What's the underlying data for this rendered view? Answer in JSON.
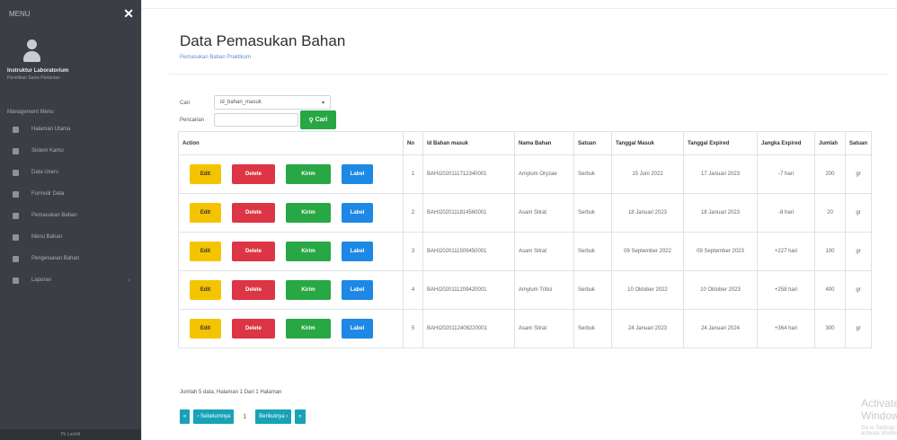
{
  "sidebar": {
    "brand": "MENU",
    "close_glyph": "✕",
    "user_name": "Instruktur Laboratorium",
    "user_role": "Penelitian Sains Pertanian",
    "section": "Management Menu",
    "items": [
      {
        "label": "Halaman Utama",
        "icon": "home-icon"
      },
      {
        "label": "Sistem Kamu",
        "icon": "system-icon"
      },
      {
        "label": "Data Users",
        "icon": "users-icon"
      },
      {
        "label": "Formulir Data",
        "icon": "form-icon"
      },
      {
        "label": "Pemasukan Bahan",
        "icon": "inbox-icon"
      },
      {
        "label": "Menu Bahan",
        "icon": "menu-icon"
      },
      {
        "label": "Pengeluaran Bahan",
        "icon": "outbox-icon"
      },
      {
        "label": "Laporan",
        "icon": "report-icon"
      }
    ],
    "footer": "Pli Lashtil"
  },
  "header": {
    "title": "Data Pemasukan Bahan",
    "subtitle": "Pemasukan Bahan Praktikum"
  },
  "search": {
    "cari_label": "Cari",
    "select_value": "id_bahan_masuk",
    "pencarian_label": "Pencarian",
    "button_label": "Cari"
  },
  "table": {
    "headers": [
      "Action",
      "No",
      "Id Bahan masuk",
      "Nama Bahan",
      "Satuan",
      "Tanggal Masuk",
      "Tanggal Expired",
      "Jangka Expired",
      "Jumlah",
      "Satuan"
    ],
    "buttons": {
      "edit": "Edit",
      "delete": "Delete",
      "kirim": "Kirim",
      "label": "Label"
    },
    "rows": [
      {
        "no": "1",
        "id": "BAHI2020111712340001",
        "nama": "Amylum Oryzae",
        "satuan": "Serbuk",
        "masuk": "15 Juni 2022",
        "expired": "17 Januari 2023",
        "jangka": "-7 hari",
        "jumlah": "200",
        "unit": "gr"
      },
      {
        "no": "2",
        "id": "BAHI2020111814560001",
        "nama": "Asam Sitrat",
        "satuan": "Serbuk",
        "masuk": "18 Januari 2023",
        "expired": "18 Januari 2023",
        "jangka": "-8 hari",
        "jumlah": "20",
        "unit": "gr"
      },
      {
        "no": "3",
        "id": "BAHI2020111509450001",
        "nama": "Asam Sitrat",
        "satuan": "Serbuk",
        "masuk": "09 September 2022",
        "expired": "09 September 2023",
        "jangka": "+227 hari",
        "jumlah": "100",
        "unit": "gr"
      },
      {
        "no": "4",
        "id": "BAHI2020111209420001",
        "nama": "Amylum Tritici",
        "satuan": "Serbuk",
        "masuk": "10 Oktober 2022",
        "expired": "10 Oktober 2023",
        "jangka": "+258 hari",
        "jumlah": "400",
        "unit": "gr"
      },
      {
        "no": "5",
        "id": "BAHI2020112408220001",
        "nama": "Asam Sitrat",
        "satuan": "Serbuk",
        "masuk": "24 Januari 2023",
        "expired": "24 Januari 2024",
        "jangka": "+364 hari",
        "jumlah": "300",
        "unit": "gr"
      }
    ]
  },
  "footer": {
    "info": "Jumlah 5 data, Halaman 1 Dari 1 Halaman",
    "first": "«",
    "prev": "‹ Sebelumnya",
    "page": "1",
    "next": "Berikutnya ›",
    "last": "»"
  },
  "watermark": {
    "line1": "Activate Windows",
    "line2": "Go to Settings to activate Windows."
  }
}
